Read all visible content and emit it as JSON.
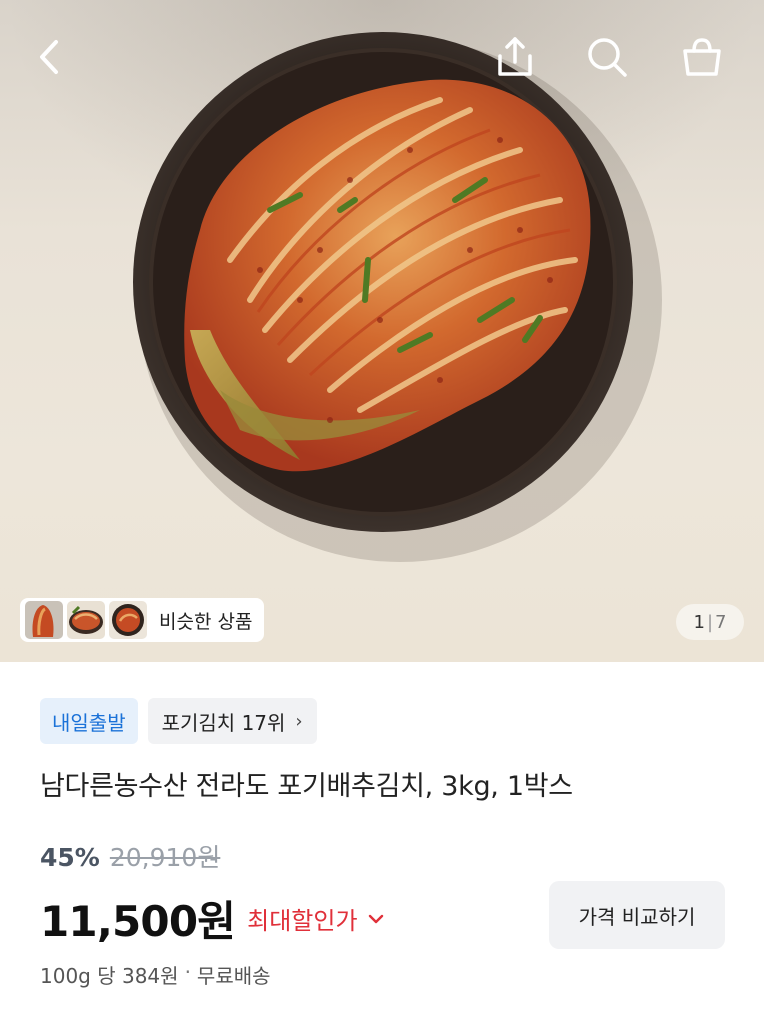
{
  "header": {
    "icons": [
      "back-icon",
      "share-icon",
      "search-icon",
      "shopping-bag-icon"
    ]
  },
  "gallery": {
    "similar_label": "비슷한 상품",
    "current_index": "1",
    "separator": "|",
    "total": "7"
  },
  "badges": {
    "delivery": "내일출발",
    "ranking": "포기김치 17위",
    "ranking_chevron": "›"
  },
  "product": {
    "title": "남다른농수산 전라도 포기배추김치, 3kg, 1박스"
  },
  "pricing": {
    "discount_percent": "45%",
    "original_price": "20,910원",
    "sale_price": "11,500원",
    "max_discount_label": "최대할인가",
    "max_discount_chevron": "⌄",
    "compare_button": "가격 비교하기",
    "unit_price": "100g 당 384원",
    "dot": "·",
    "shipping": "무료배송"
  },
  "colors": {
    "accent_blue": "#1b72d8",
    "badge_blue_bg": "#e6f0fb",
    "sale_red": "#e0303a",
    "muted_gray": "#9aa0a8"
  }
}
